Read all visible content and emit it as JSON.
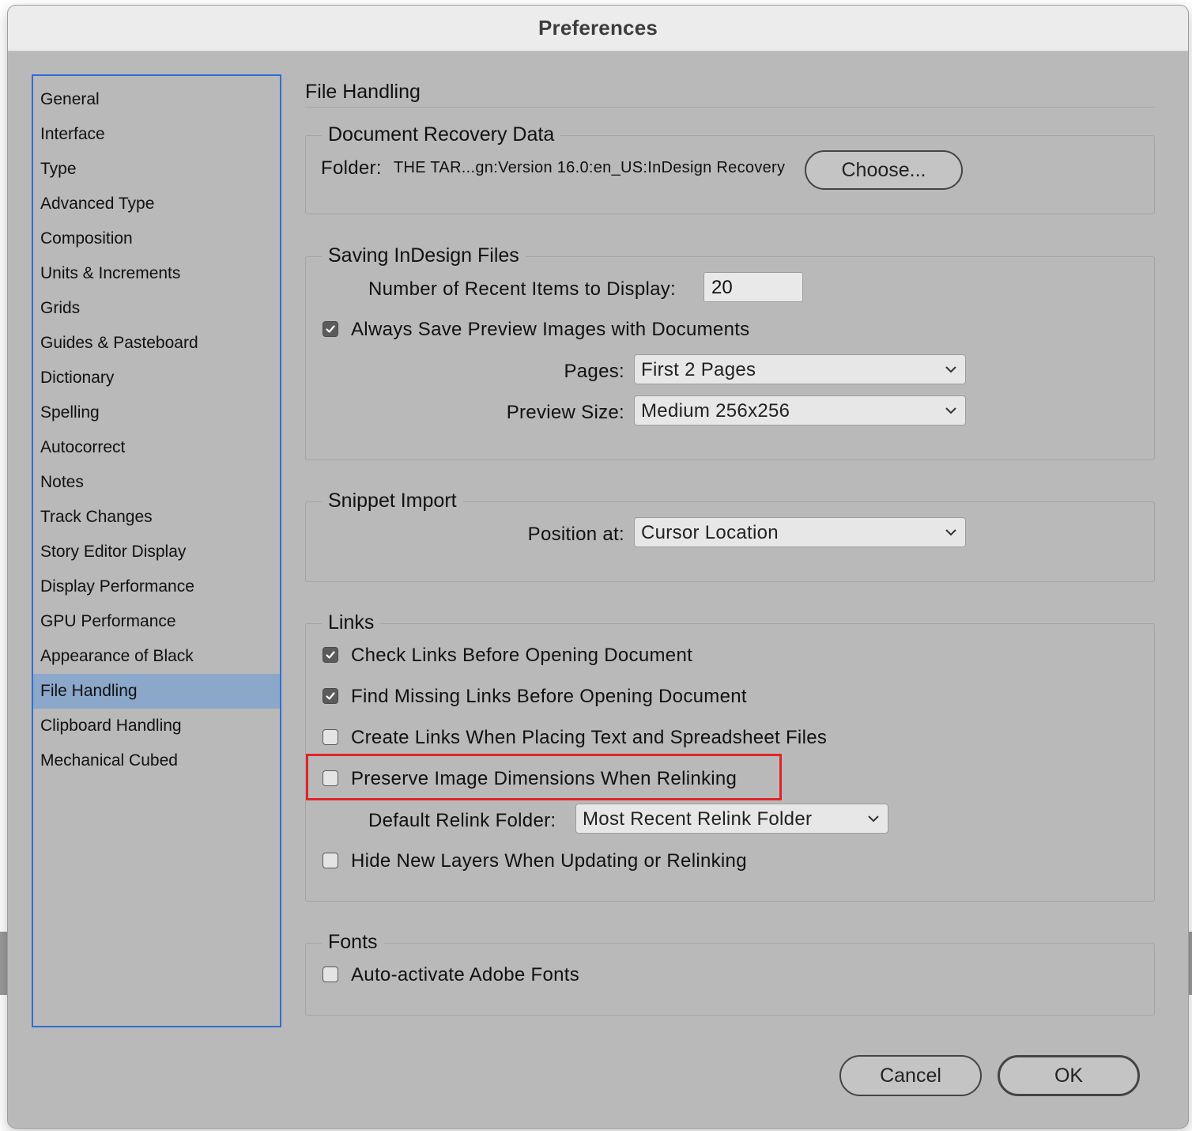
{
  "window": {
    "title": "Preferences"
  },
  "sidebar": {
    "items": [
      {
        "label": "General",
        "selected": false
      },
      {
        "label": "Interface",
        "selected": false
      },
      {
        "label": "Type",
        "selected": false
      },
      {
        "label": "Advanced Type",
        "selected": false
      },
      {
        "label": "Composition",
        "selected": false
      },
      {
        "label": "Units & Increments",
        "selected": false
      },
      {
        "label": "Grids",
        "selected": false
      },
      {
        "label": "Guides & Pasteboard",
        "selected": false
      },
      {
        "label": "Dictionary",
        "selected": false
      },
      {
        "label": "Spelling",
        "selected": false
      },
      {
        "label": "Autocorrect",
        "selected": false
      },
      {
        "label": "Notes",
        "selected": false
      },
      {
        "label": "Track Changes",
        "selected": false
      },
      {
        "label": "Story Editor Display",
        "selected": false
      },
      {
        "label": "Display Performance",
        "selected": false
      },
      {
        "label": "GPU Performance",
        "selected": false
      },
      {
        "label": "Appearance of Black",
        "selected": false
      },
      {
        "label": "File Handling",
        "selected": true
      },
      {
        "label": "Clipboard Handling",
        "selected": false
      },
      {
        "label": "Mechanical Cubed",
        "selected": false
      }
    ]
  },
  "panel": {
    "title": "File Handling",
    "recovery": {
      "heading": "Document Recovery Data",
      "folder_label": "Folder:",
      "folder_path": "THE TAR...gn:Version 16.0:en_US:InDesign Recovery",
      "choose_label": "Choose..."
    },
    "saving": {
      "heading": "Saving InDesign Files",
      "recent_label": "Number of Recent Items to Display:",
      "recent_value": "20",
      "always_save_label": "Always Save Preview Images with Documents",
      "always_save_checked": true,
      "pages_label": "Pages:",
      "pages_value": "First 2 Pages",
      "preview_size_label": "Preview Size:",
      "preview_size_value": "Medium 256x256"
    },
    "snippet": {
      "heading": "Snippet Import",
      "position_label": "Position at:",
      "position_value": "Cursor Location"
    },
    "links": {
      "heading": "Links",
      "check_links": {
        "label": "Check Links Before Opening Document",
        "checked": true
      },
      "find_missing": {
        "label": "Find Missing Links Before Opening Document",
        "checked": true
      },
      "create_links": {
        "label": "Create Links When Placing Text and Spreadsheet Files",
        "checked": false
      },
      "preserve_dims": {
        "label": "Preserve Image Dimensions When Relinking",
        "checked": false
      },
      "relink_folder_label": "Default Relink Folder:",
      "relink_folder_value": "Most Recent Relink Folder",
      "hide_layers": {
        "label": "Hide New Layers When Updating or Relinking",
        "checked": false
      }
    },
    "fonts": {
      "heading": "Fonts",
      "auto_activate": {
        "label": "Auto-activate Adobe Fonts",
        "checked": false
      }
    }
  },
  "buttons": {
    "cancel": "Cancel",
    "ok": "OK"
  },
  "colors": {
    "window_bg": "#b9b9b9",
    "titlebar_bg": "#ececec",
    "selection": "#8ba7c9",
    "focus_ring": "#2f6fd6",
    "highlight": "#e0242c"
  }
}
